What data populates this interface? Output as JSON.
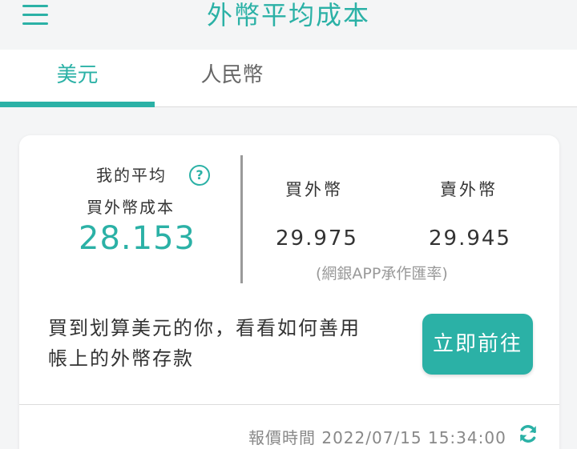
{
  "header": {
    "title": "外幣平均成本",
    "menu_icon": "hamburger-menu-icon"
  },
  "tabs": [
    {
      "label": "美元",
      "active": true
    },
    {
      "label": "人民幣",
      "active": false
    }
  ],
  "summary": {
    "avg_label_line1": "我的平均",
    "avg_label_line2": "買外幣成本",
    "avg_value": "28.153",
    "help_icon": "question-circle-icon",
    "buy_label": "買外幣",
    "buy_value": "29.975",
    "sell_label": "賣外幣",
    "sell_value": "29.945",
    "rate_note": "(網銀APP承作匯率)"
  },
  "promo": {
    "line1": "買到划算美元的你，看看如何善用",
    "line2": "帳上的外幣存款",
    "button_label": "立即前往"
  },
  "footer": {
    "quote_time": "報價時間 2022/07/15 15:34:00",
    "refresh_icon": "refresh-icon"
  },
  "colors": {
    "accent": "#2bb1a6",
    "background": "#f4f5f6",
    "card": "#ffffff",
    "muted_text": "#999999"
  }
}
